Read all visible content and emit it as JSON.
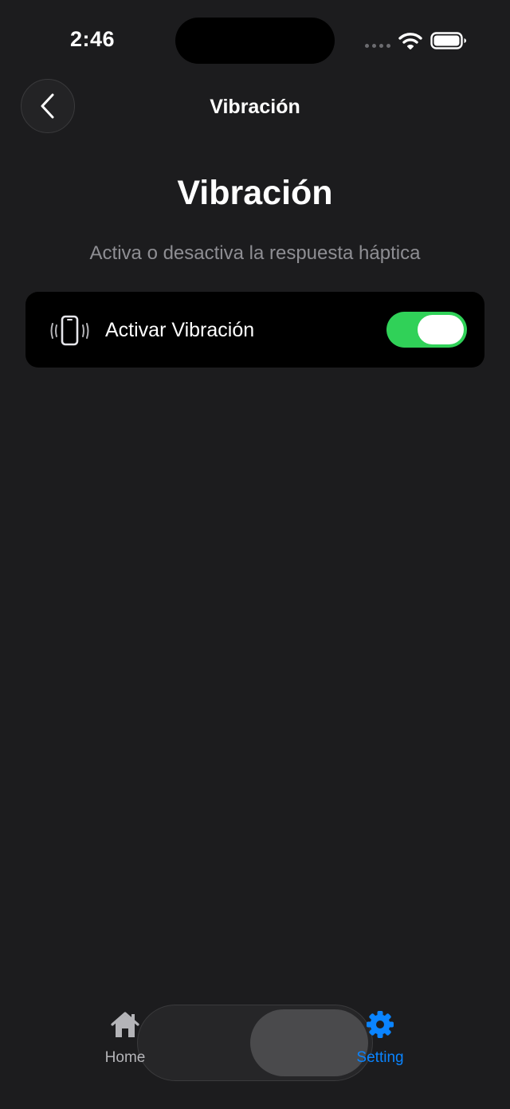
{
  "status_bar": {
    "time": "2:46"
  },
  "nav": {
    "title": "Vibración",
    "back_icon": "chevron-left-icon"
  },
  "page": {
    "title": "Vibración",
    "subtitle": "Activa o desactiva la respuesta háptica"
  },
  "settings": {
    "rows": [
      {
        "icon": "phone-vibration-icon",
        "label": "Activar Vibración",
        "enabled": true
      }
    ]
  },
  "tab_bar": {
    "items": [
      {
        "label": "Home",
        "icon": "house-icon",
        "selected": false
      },
      {
        "label": "Setting",
        "icon": "gear-icon",
        "selected": true
      }
    ]
  },
  "colors": {
    "background": "#1c1c1e",
    "card": "#000000",
    "toggle_on": "#30d158",
    "accent": "#0a84ff",
    "secondary_text": "#8e8e93"
  }
}
